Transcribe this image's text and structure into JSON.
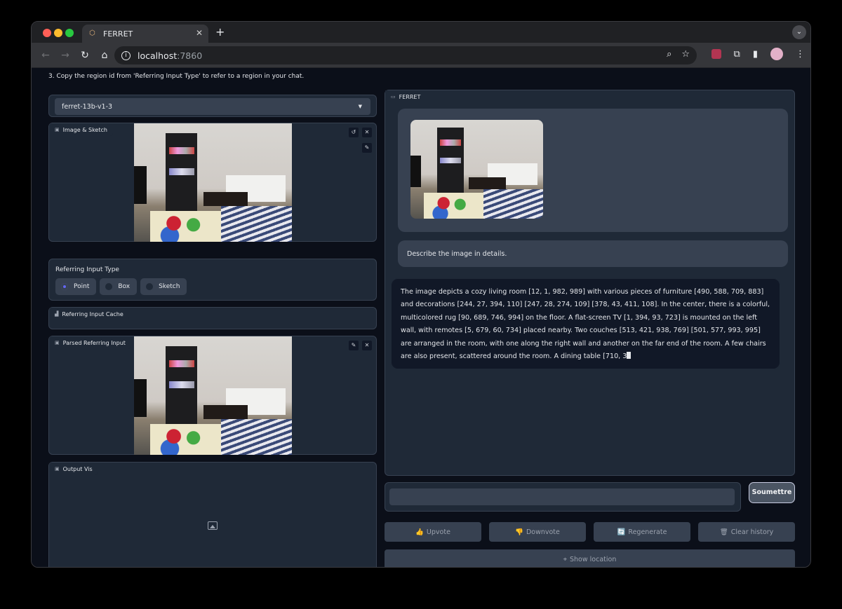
{
  "browser": {
    "tab_title": "FERRET",
    "url_host": "localhost",
    "url_port": ":7860",
    "icons": [
      "back-icon",
      "forward-icon",
      "reload-icon",
      "home-icon",
      "info-icon",
      "zoom-icon",
      "bookmark-star-icon",
      "extension-icon",
      "puzzle-icon",
      "sidebar-icon",
      "profile-avatar",
      "menu-icon"
    ]
  },
  "instruction": "3. Copy the region id from 'Referring Input Type' to refer to a region in your chat.",
  "left": {
    "model_select": {
      "value": "ferret-13b-v1-3"
    },
    "image_sketch": {
      "label": "Image & Sketch"
    },
    "referring_input_type": {
      "label": "Referring Input Type",
      "options": [
        {
          "label": "Point",
          "checked": true
        },
        {
          "label": "Box",
          "checked": false
        },
        {
          "label": "Sketch",
          "checked": false
        }
      ]
    },
    "referring_input_cache": {
      "label": "Referring Input Cache"
    },
    "parsed_referring_input": {
      "label": "Parsed Referring Input"
    },
    "output_vis": {
      "label": "Output Vis"
    }
  },
  "chat": {
    "label": "FERRET",
    "user_message": "Describe the image in details.",
    "bot_message": "The image depicts a cozy living room [12, 1, 982, 989] with various pieces of furniture [490, 588, 709, 883] and decorations [244, 27, 394, 110] [247, 28, 274, 109] [378, 43, 411, 108]. In the center, there is a colorful, multicolored rug [90, 689, 746, 994] on the floor. A flat-screen TV [1, 394, 93, 723] is mounted on the left wall, with remotes [5, 679, 60, 734] placed nearby. Two couches [513, 421, 938, 769] [501, 577, 993, 995] are arranged in the room, with one along the right wall and another on the far end of the room. A few chairs are also present, scattered around the room. A dining table [710, 3"
  },
  "input": {
    "placeholder": "",
    "submit_label": "Soumettre"
  },
  "actions": {
    "upvote": "Upvote",
    "downvote": "Downvote",
    "regenerate": "Regenerate",
    "clear_history": "Clear history",
    "show_location": "Show location"
  },
  "colors": {
    "accent": "#6366f1",
    "panel": "#1f2937",
    "background": "#0b0f19"
  }
}
